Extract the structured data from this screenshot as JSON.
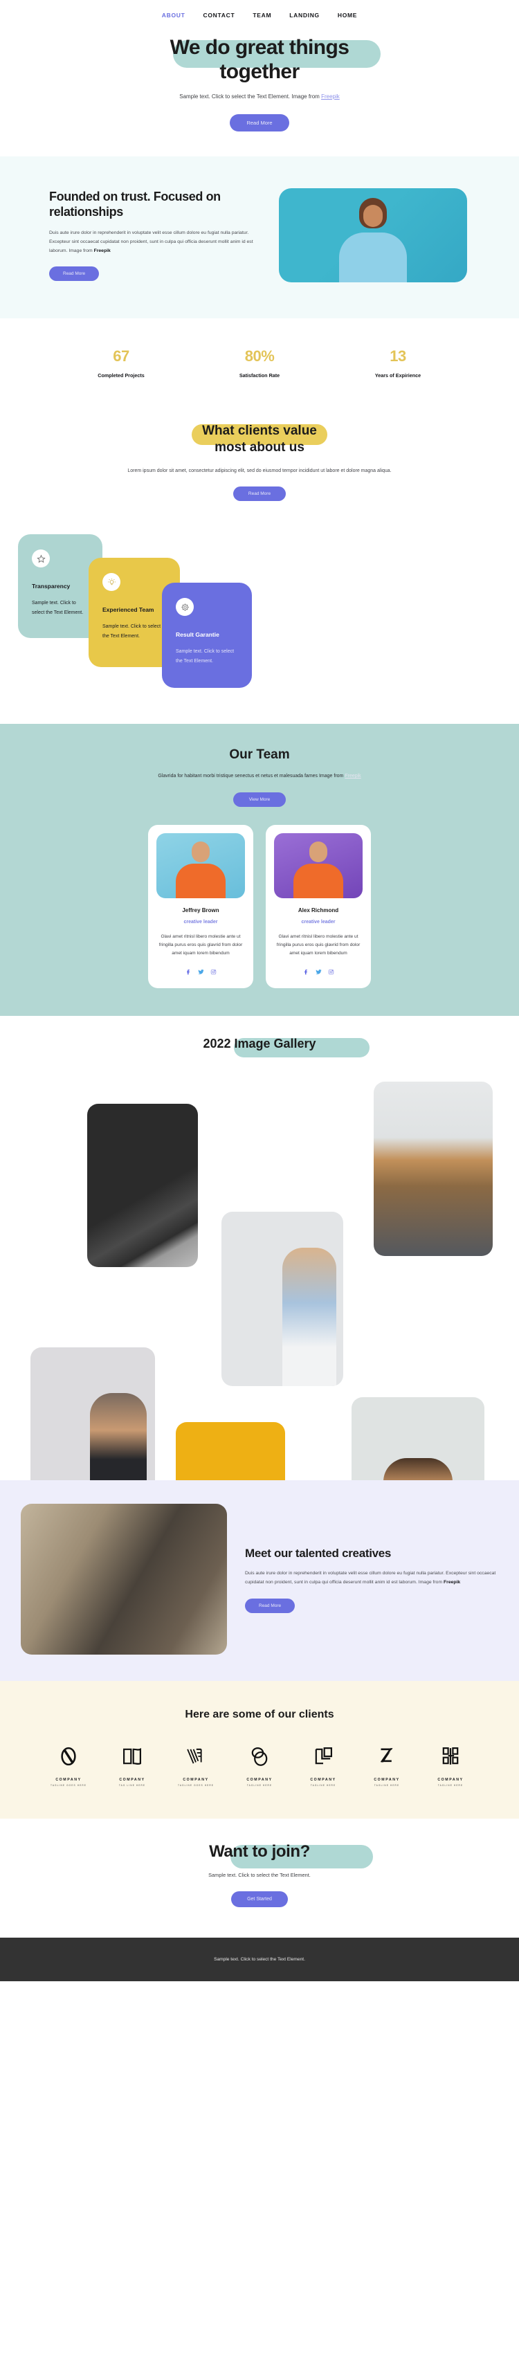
{
  "nav": {
    "items": [
      {
        "label": "ABOUT",
        "active": true
      },
      {
        "label": "CONTACT",
        "active": false
      },
      {
        "label": "TEAM",
        "active": false
      },
      {
        "label": "LANDING",
        "active": false
      },
      {
        "label": "HOME",
        "active": false
      }
    ]
  },
  "hero": {
    "title_line1": "We do great things",
    "title_line2": "together",
    "subtitle": "Sample text. Click to select the Text Element. Image from ",
    "subtitle_link": "Freepik",
    "button": "Read More",
    "highlight_color": "#afd8d4"
  },
  "founded": {
    "title": "Founded on trust. Focused on relationships",
    "body": "Duis aute irure dolor in reprehenderit in voluptate velit esse cillum dolore eu fugiat nulla pariatur. Excepteur sint occaecat cupidatat non proident, sunt in culpa qui officia deserunt mollit anim id est laborum. Image from ",
    "body_bold": "Freepik",
    "button": "Read More",
    "bg_color": "#f2fafa",
    "image_alt": "smiling-woman-in-blue-sweater"
  },
  "stats": {
    "items": [
      {
        "value": "67",
        "label": "Completed Projects"
      },
      {
        "value": "80%",
        "label": "Satisfaction Rate"
      },
      {
        "value": "13",
        "label": "Years of Expirience"
      }
    ],
    "number_color": "#e3c458"
  },
  "values": {
    "title_line1": "What clients value",
    "title_line2": "most about us",
    "subtitle": "Lorem ipsum dolor sit amet, consectetur adipiscing elit, sed do eiusmod tempor incididunt ut labore et dolore magna aliqua.",
    "button": "Read More",
    "highlight_color": "#eace5c",
    "cards": [
      {
        "icon": "star-icon",
        "title": "Transparency",
        "text": "Sample text. Click to select the Text Element.",
        "color": "#aed5d1"
      },
      {
        "icon": "lightbulb-icon",
        "title": "Experienced Team",
        "text": "Sample text. Click to select the Text Element.",
        "color": "#e8c849"
      },
      {
        "icon": "gear-icon",
        "title": "Result Garantie",
        "text": "Sample text. Click to select the Text Element.",
        "color": "#6a6fe0"
      }
    ]
  },
  "team": {
    "title": "Our Team",
    "subtitle": "Glavrida for habitant morbi tristique senectus et netus et malesuada fames Image from ",
    "subtitle_link": "Freepik",
    "button": "View More",
    "bg_color": "#b3d7d3",
    "members": [
      {
        "name": "Jeffrey Brown",
        "role": "creative leader",
        "desc": "Glavi amet ritnisl libero molestie ante ut fringilla purus eros quis glavrid from dolor amet iquam lorem bibendum",
        "photo_bg": "#6fc3dd"
      },
      {
        "name": "Alex Richmond",
        "role": "creative leader",
        "desc": "Glavi amet ritnisl libero molestie ante ut fringilla purus eros quis glavrid from dolor amet iquam lorem bibendum",
        "photo_bg": "#8a5cc8"
      }
    ],
    "social_icons": [
      "facebook-icon",
      "twitter-icon",
      "instagram-icon"
    ]
  },
  "gallery": {
    "title": "2022 Image Gallery",
    "highlight_color": "#afd8d4",
    "images": [
      {
        "alt": "dark-wall-shadow"
      },
      {
        "alt": "office-meeting-room"
      },
      {
        "alt": "woman-in-blue-shirt"
      },
      {
        "alt": "man-in-black-tshirt"
      },
      {
        "alt": "surprised-woman-yellow-bg"
      },
      {
        "alt": "woman-with-laptop-celebrating"
      }
    ]
  },
  "creatives": {
    "title": "Meet our talented creatives",
    "body": "Duis aute irure dolor in reprehenderit in voluptate velit esse cillum dolore eu fugiat nulla pariatur. Excepteur sint occaecat cupidatat non proident, sunt in culpa qui officia deserunt mollit anim id est laborum. Image from ",
    "body_bold": "Freepik",
    "button": "Read More",
    "bg_color": "#eeeefb",
    "image_alt": "group-of-friends-talking"
  },
  "clients": {
    "title": "Here are some of our clients",
    "bg_color": "#fbf6e6",
    "logos": [
      {
        "icon": "logo-ring-o",
        "name": "COMPANY",
        "tagline": "TAGLINE GOES HERE"
      },
      {
        "icon": "logo-open-book",
        "name": "COMPANY",
        "tagline": "TAG LINE HERE"
      },
      {
        "icon": "logo-v-stripes",
        "name": "COMPANY",
        "tagline": "TAGLINE GOES HERE"
      },
      {
        "icon": "logo-double-circle",
        "name": "COMPANY",
        "tagline": "TAGLINE HERE"
      },
      {
        "icon": "logo-square-corner",
        "name": "COMPANY",
        "tagline": "TAGLINE HERE"
      },
      {
        "icon": "logo-slash-bars",
        "name": "COMPANY",
        "tagline": "TAGLINE HERE"
      },
      {
        "icon": "logo-block-b",
        "name": "COMPANY",
        "tagline": "TAGLINE HERE"
      }
    ]
  },
  "join": {
    "title": "Want to join?",
    "subtitle": "Sample text. Click to select the Text Element.",
    "button": "Get Started",
    "highlight_color": "#afd8d4"
  },
  "footer": {
    "text": "Sample text. Click to select the Text Element.",
    "bg_color": "#333333"
  }
}
